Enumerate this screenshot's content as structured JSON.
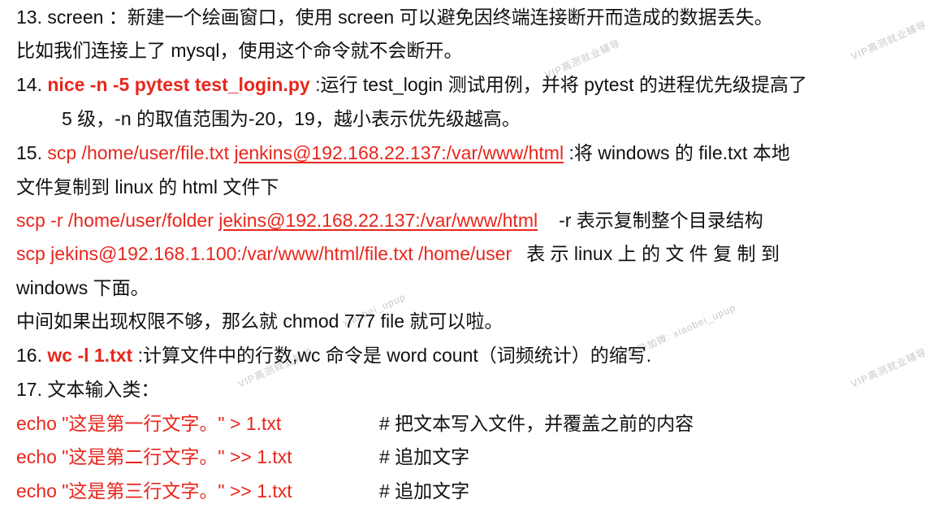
{
  "watermarks": {
    "a": "VIP高测就业辅导",
    "b": "VIP高测就业辅导",
    "c": "xiaobei_upup",
    "d": "辅导加微: xiaobei_upup",
    "e": "VIP高测就业辅导",
    "f": "VIP高测就业辅导"
  },
  "items": {
    "s13": {
      "line1": "13. screen ：新建一个绘画窗口，使用 screen 可以避免因终端连接断开而造成的数据丢失。",
      "line2": "比如我们连接上了 mysql，使用这个命令就不会断开。"
    },
    "s14": {
      "num": "14. ",
      "cmd": "nice -n -5 pytest test_login.py",
      "desc": " :运行 test_login 测试用例，并将 pytest 的进程优先级提高了",
      "line2": "5 级，-n 的取值范围为-20，19，越小表示优先级越高。"
    },
    "s15": {
      "num": "15. ",
      "cmd_a": "scp /home/user/file.txt ",
      "cmd_b": "jenkins@192.168.22.137:/var/www/html",
      "desc": " :将 windows 的 file.txt 本地",
      "line2": "文件复制到 linux 的 html 文件下",
      "r_cmd_a": "scp -r /home/user/folder ",
      "r_cmd_b": "jekins@192.168.22.137:/var/www/html",
      "r_desc": "-r 表示复制整个目录结构",
      "down_cmd": "scp  jekins@192.168.1.100:/var/www/html/file.txt  /home/user",
      "down_desc": "表 示  linux  上 的 文 件 复 制 到",
      "down_line2": "windows 下面。",
      "perm": "中间如果出现权限不够，那么就 chmod 777 file 就可以啦。"
    },
    "s16": {
      "num": "16. ",
      "cmd": "wc -l 1.txt",
      "desc": " :计算文件中的行数,wc  命令是  word count（词频统计）的缩写."
    },
    "s17": {
      "title": "17. 文本输入类：",
      "rows": [
        {
          "cmd": "echo \"这是第一行文字。\" > 1.txt",
          "comment": "#  把文本写入文件，并覆盖之前的内容"
        },
        {
          "cmd": "echo \"这是第二行文字。\" >> 1.txt",
          "comment": "#  追加文字"
        },
        {
          "cmd": "echo \"这是第三行文字。\" >> 1.txt",
          "comment": "#  追加文字"
        }
      ]
    }
  },
  "colors": {
    "text": "#111111",
    "accent_red": "#e8261c",
    "watermark": "#c8c8c8"
  }
}
